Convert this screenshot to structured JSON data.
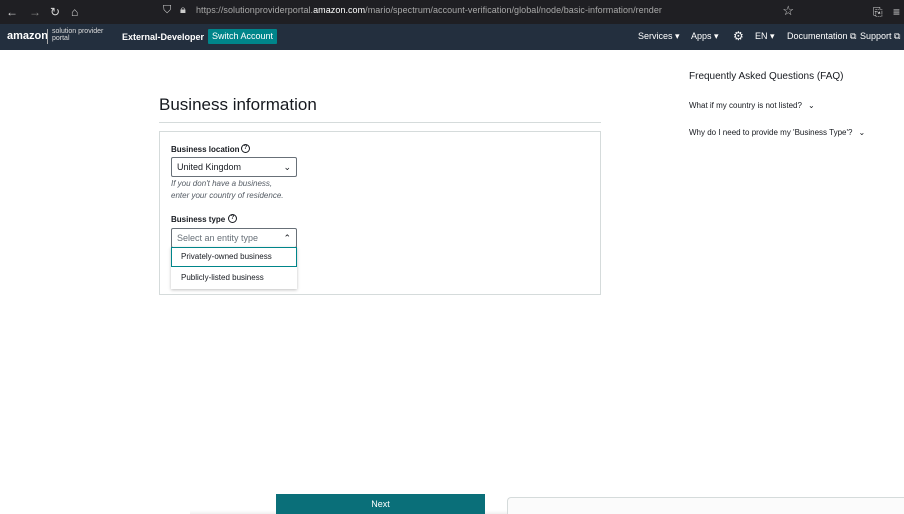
{
  "browser": {
    "back_icon": "arrow-left-icon",
    "forward_icon": "arrow-right-icon",
    "reload_icon": "reload-icon",
    "home_icon": "home-icon",
    "url_prefix": "https://solutionproviderportal.",
    "url_domain": "amazon.com",
    "url_path": "/mario/spectrum/account-verification/global/node/basic-information/render"
  },
  "topnav": {
    "logo": "amazon",
    "logo_sub": "solution provider portal",
    "account_name": "External-Developer",
    "switch_account": "Switch Account",
    "services": "Services ▾",
    "apps": "Apps ▾",
    "language": "EN ▾",
    "documentation": "Documentation ⧉",
    "support": "Support ⧉"
  },
  "main": {
    "title": "Business information",
    "location_label": "Business location",
    "location_value": "United Kingdom",
    "location_hint_1": "If you don't have a business,",
    "location_hint_2": "enter your country of residence.",
    "type_label": "Business type",
    "type_placeholder": "Select an entity type",
    "type_options": [
      "Privately-owned business",
      "Publicly-listed business"
    ]
  },
  "faq": {
    "title": "Frequently Asked Questions (FAQ)",
    "questions": [
      "What if my country is not listed?",
      "Why do I need to provide my 'Business Type'?"
    ]
  },
  "footer": {
    "next": "Next"
  },
  "colors": {
    "nav_bg": "#232f3e",
    "accent": "#00858a",
    "button": "#0a6f79"
  }
}
